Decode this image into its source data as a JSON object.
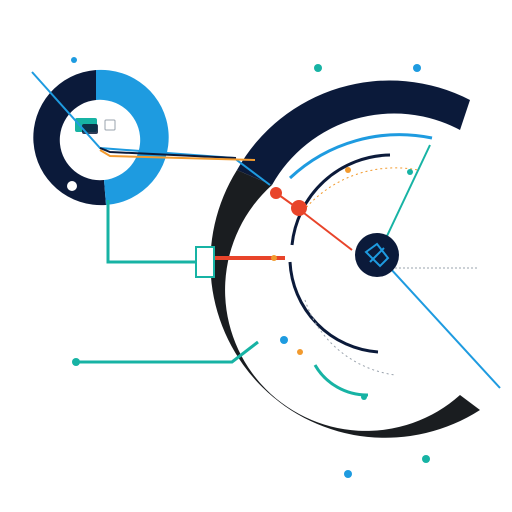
{
  "colors": {
    "navy": "#0b1a3a",
    "black": "#1a1d20",
    "blue": "#1e9be0",
    "teal": "#17b3a4",
    "red": "#e8442a",
    "orange": "#f29a2e",
    "gray": "#9aa3ad"
  },
  "icons": {
    "hub": "compass-node-icon",
    "donut_inner": "cluster-icon",
    "small_node": "toggle-node-icon"
  },
  "labels": {
    "top_left_title": "",
    "top_left_sub": "",
    "mid_left_title": "",
    "mid_left_sub": ""
  },
  "legend": [
    {
      "color": "#17b3a4",
      "label": ""
    },
    {
      "color": "#1e9be0",
      "label": ""
    },
    {
      "color": "#1e9be0",
      "label": ""
    },
    {
      "color": "#17b3a4",
      "label": ""
    }
  ],
  "donut": {
    "segments": [
      {
        "color": "#1e9be0",
        "fraction": 0.47
      },
      {
        "color": "#0b1a3a",
        "fraction": 0.53
      }
    ]
  }
}
